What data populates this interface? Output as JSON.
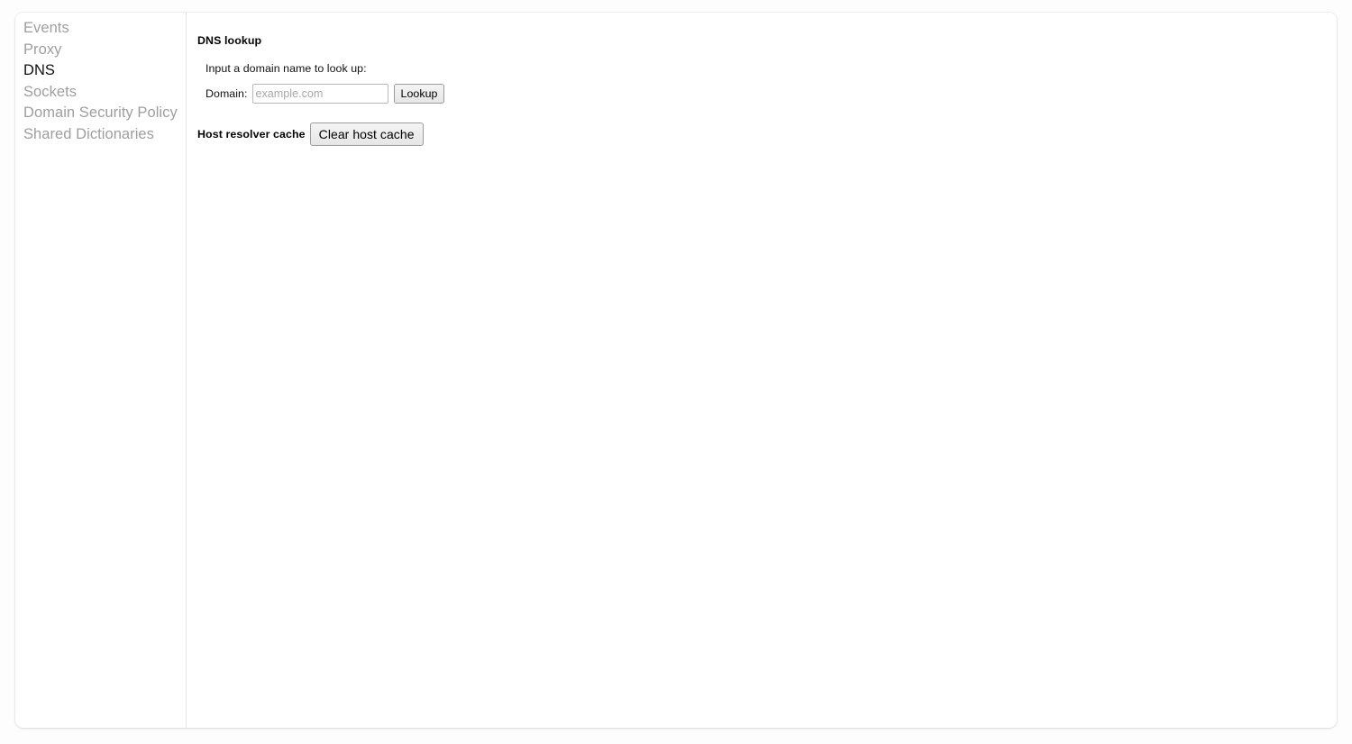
{
  "sidebar": {
    "items": [
      {
        "label": "Events",
        "selected": false
      },
      {
        "label": "Proxy",
        "selected": false
      },
      {
        "label": "DNS",
        "selected": true
      },
      {
        "label": "Sockets",
        "selected": false
      },
      {
        "label": "Domain Security Policy",
        "selected": false
      },
      {
        "label": "Shared Dictionaries",
        "selected": false
      }
    ]
  },
  "main": {
    "section_title": "DNS lookup",
    "prompt": "Input a domain name to look up:",
    "domain_label": "Domain:",
    "domain_value": "",
    "domain_placeholder": "example.com",
    "lookup_button": "Lookup",
    "cache_label": "Host resolver cache",
    "clear_cache_button": "Clear host cache"
  },
  "colors": {
    "selected_text": "#111111",
    "muted_text": "#9e9e9e",
    "panel_background": "#ffffff",
    "page_background": "#fdfdfd",
    "divider": "#e3e3e3"
  }
}
